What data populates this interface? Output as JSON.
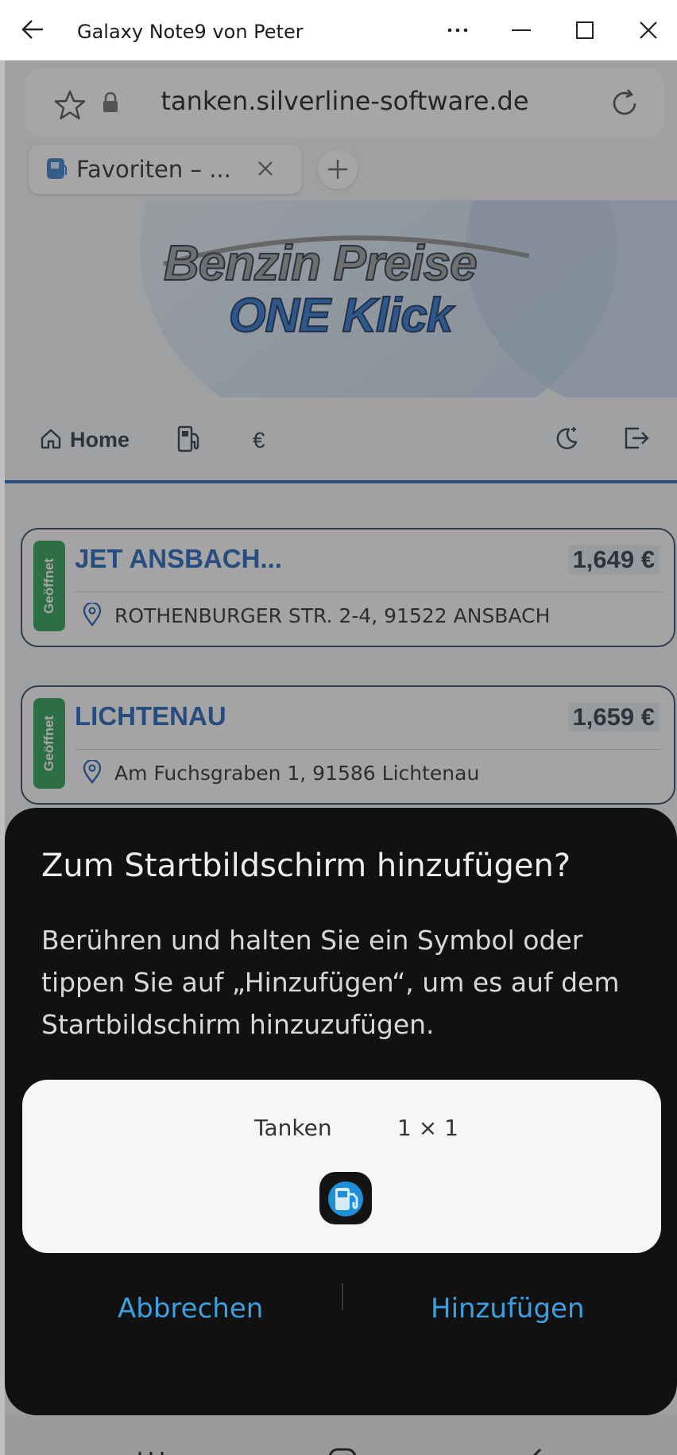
{
  "window": {
    "title": "Galaxy Note9 von Peter"
  },
  "browser": {
    "url": "tanken.silverline-software.de",
    "tab_label": "Favoriten – ..."
  },
  "banner": {
    "line1": "Benzin Preise",
    "line2": "ONE Klick"
  },
  "nav": {
    "home_label": "Home",
    "euro_label": "€"
  },
  "stations": [
    {
      "status": "Geöffnet",
      "name": "JET ANSBACH...",
      "price": "1,649 €",
      "address": "ROTHENBURGER STR. 2-4, 91522 ANSBACH"
    },
    {
      "status": "Geöffnet",
      "name": "LICHTENAU",
      "price": "1,659 €",
      "address": "Am Fuchsgraben 1, 91586 Lichtenau"
    }
  ],
  "dialog": {
    "title": "Zum Startbildschirm hinzufügen?",
    "body": "Berühren und halten Sie ein Symbol oder tippen Sie auf „Hinzufügen“, um es auf dem Startbildschirm hinzuzufügen.",
    "widget_name": "Tanken",
    "widget_size": "1 × 1",
    "cancel_label": "Abbrechen",
    "add_label": "Hinzufügen"
  },
  "colors": {
    "accent_blue": "#1659b8",
    "status_green": "#1f9a4c",
    "dialog_button": "#3aa0e2",
    "dialog_bg": "#111111"
  }
}
